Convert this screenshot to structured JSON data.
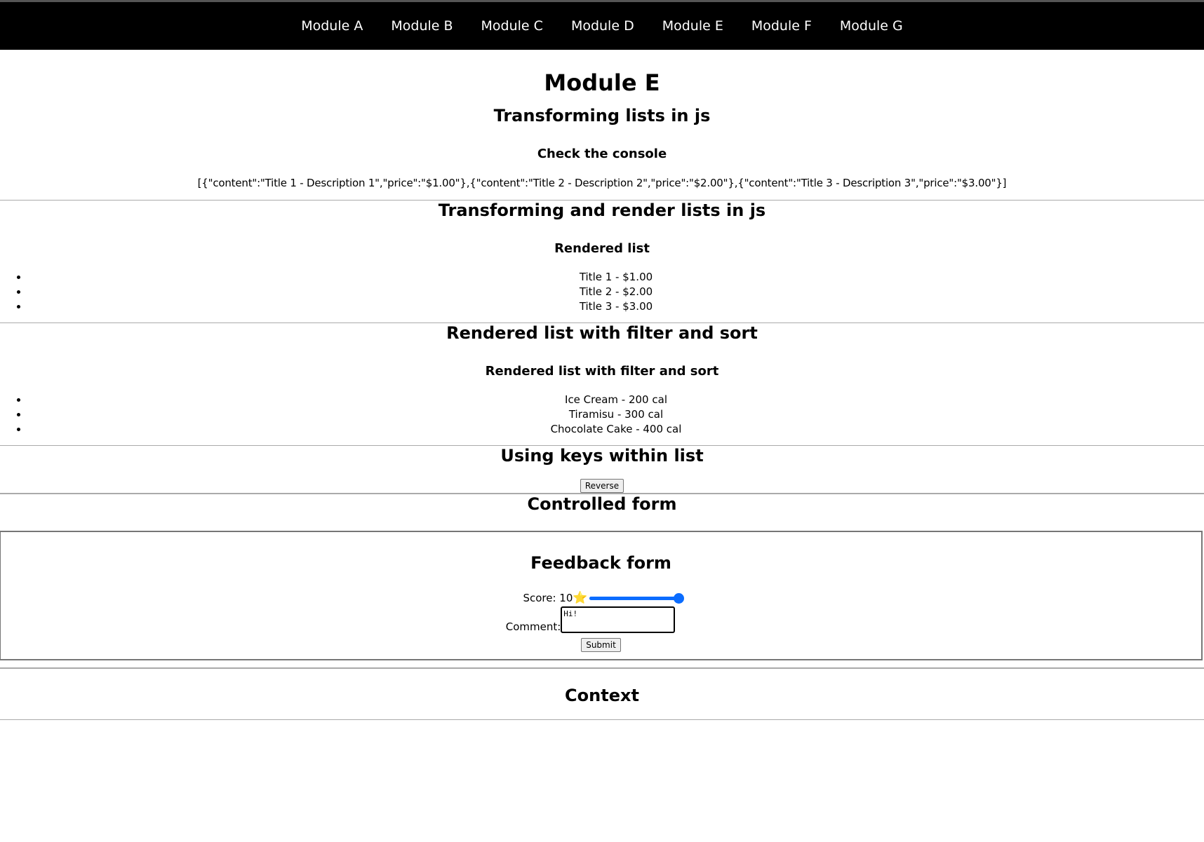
{
  "nav": {
    "items": [
      {
        "label": "Module A"
      },
      {
        "label": "Module B"
      },
      {
        "label": "Module C"
      },
      {
        "label": "Module D"
      },
      {
        "label": "Module E"
      },
      {
        "label": "Module F"
      },
      {
        "label": "Module G"
      }
    ]
  },
  "page": {
    "title": "Module E"
  },
  "section1": {
    "heading": "Transforming lists in js",
    "subheading": "Check the console",
    "json_output": "[{\"content\":\"Title 1 - Description 1\",\"price\":\"$1.00\"},{\"content\":\"Title 2 - Description 2\",\"price\":\"$2.00\"},{\"content\":\"Title 3 - Description 3\",\"price\":\"$3.00\"}]"
  },
  "section2": {
    "heading": "Transforming and render lists in js",
    "subheading": "Rendered list",
    "items": [
      "Title 1 - $1.00",
      "Title 2 - $2.00",
      "Title 3 - $3.00"
    ]
  },
  "section3": {
    "heading": "Rendered list with filter and sort",
    "subheading": "Rendered list with filter and sort",
    "items": [
      "Ice Cream - 200 cal",
      "Tiramisu - 300 cal",
      "Chocolate Cake - 400 cal"
    ]
  },
  "section4": {
    "heading": "Using keys within list",
    "button_label": "Reverse"
  },
  "section5": {
    "heading": "Controlled form",
    "form": {
      "heading": "Feedback form",
      "score_label": "Score: 10",
      "score_icon": "star-icon",
      "score_value": 10,
      "score_max": 10,
      "comment_label": "Comment:",
      "comment_value": "Hi!",
      "submit_label": "Submit"
    }
  },
  "section6": {
    "heading": "Context"
  },
  "colors": {
    "nav_bg": "#000000",
    "slider": "#0a6cff",
    "star": "#f5c518"
  }
}
